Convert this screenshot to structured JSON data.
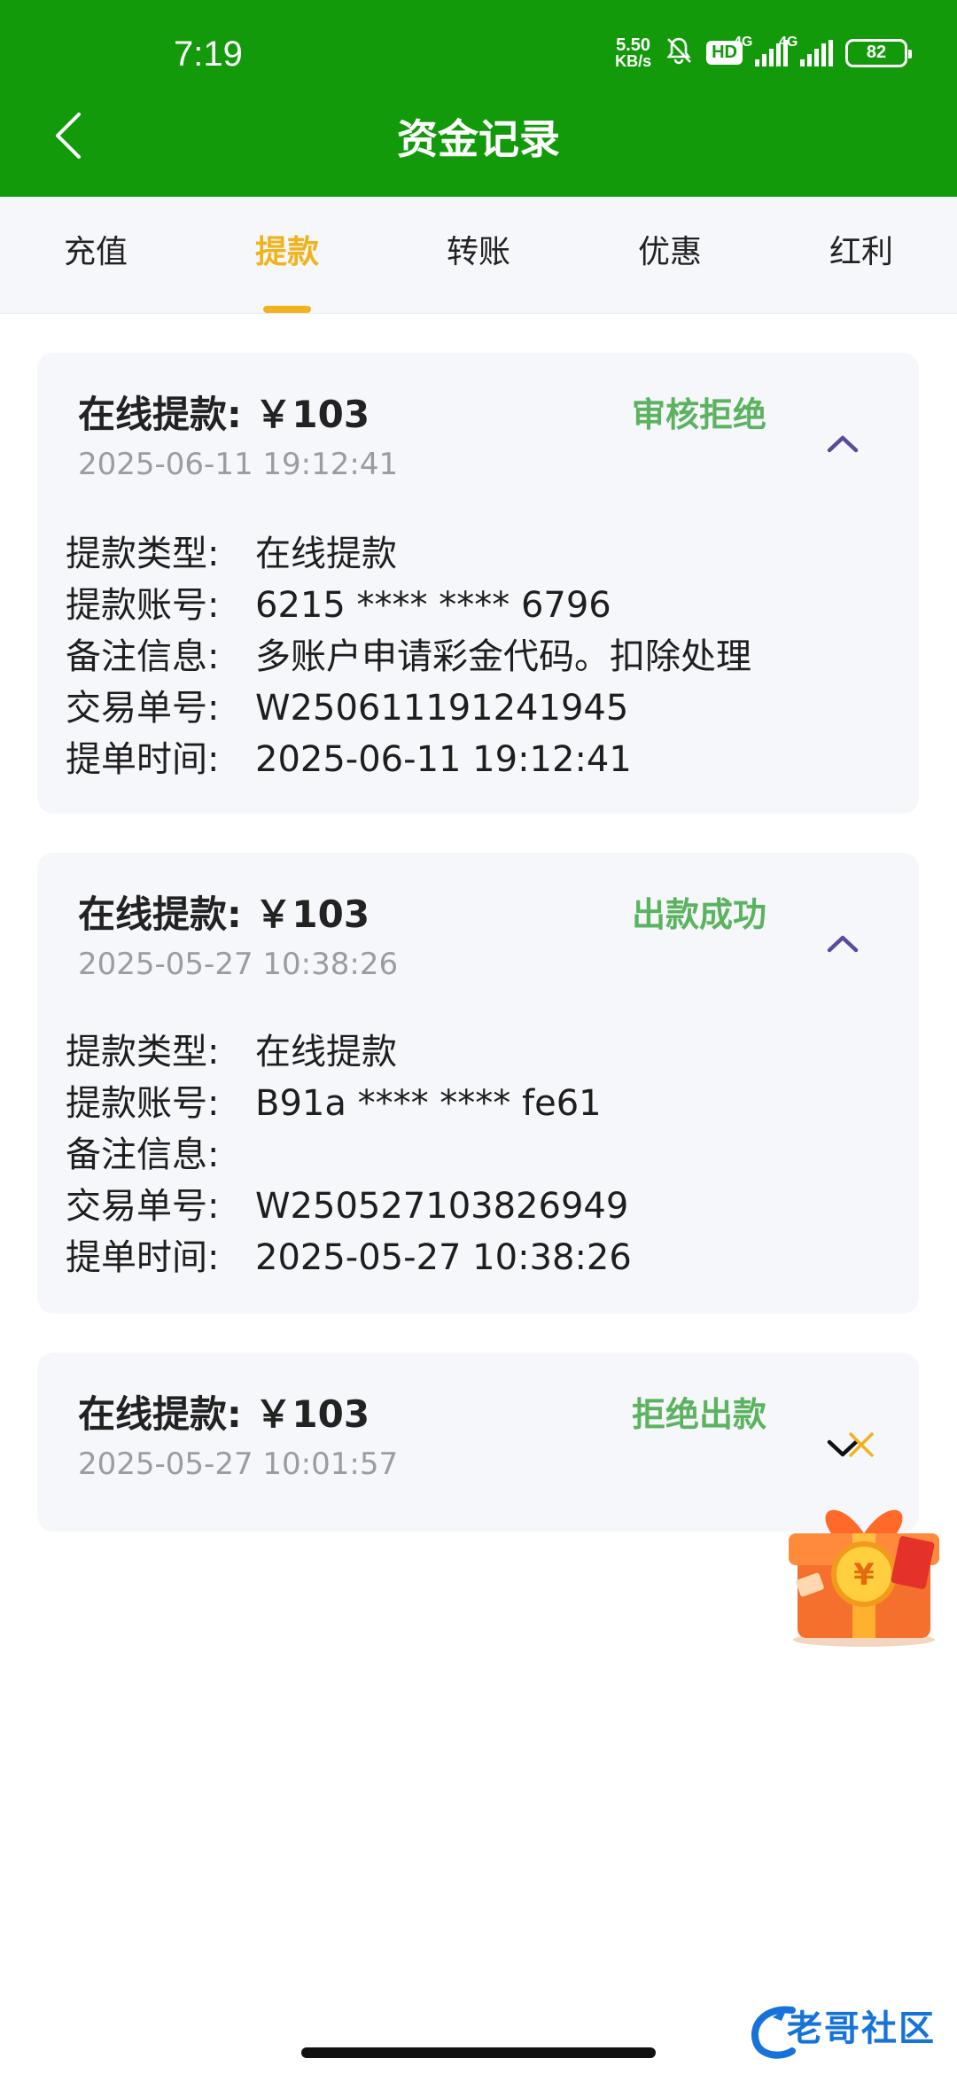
{
  "status_bar": {
    "time": "7:19",
    "net_speed_value": "5.50",
    "net_speed_unit": "KB/s",
    "hd_label": "HD",
    "net_label_1": "4G",
    "net_label_2": "4G",
    "battery": "82",
    "icons": [
      "mute-bell-icon",
      "hd-icon",
      "signal-icon",
      "signal-icon",
      "battery-icon"
    ]
  },
  "header": {
    "title": "资金记录",
    "back_icon": "chevron-left-icon"
  },
  "tabs": [
    {
      "label": "充值",
      "active": false
    },
    {
      "label": "提款",
      "active": true
    },
    {
      "label": "转账",
      "active": false
    },
    {
      "label": "优惠",
      "active": false
    },
    {
      "label": "红利",
      "active": false
    }
  ],
  "colors": {
    "header_bg": "#139a0a",
    "tab_active": "#f0b31c",
    "status_green": "#5bb360",
    "chevron": "#5b4b9b"
  },
  "records": [
    {
      "amount_line": "在线提款: ￥103",
      "date": "2025-06-11 19:12:41",
      "status": "审核拒绝",
      "expanded": true,
      "details": [
        {
          "key": "提款类型:",
          "value": "在线提款"
        },
        {
          "key": "提款账号:",
          "value": "6215 **** **** 6796"
        },
        {
          "key": "备注信息:",
          "value": "多账户申请彩金代码。扣除处理"
        },
        {
          "key": "交易单号:",
          "value": "W250611191241945"
        },
        {
          "key": "提单时间:",
          "value": "2025-06-11 19:12:41"
        }
      ]
    },
    {
      "amount_line": "在线提款: ￥103",
      "date": "2025-05-27 10:38:26",
      "status": "出款成功",
      "expanded": true,
      "details": [
        {
          "key": "提款类型:",
          "value": "在线提款"
        },
        {
          "key": "提款账号:",
          "value": "B91a **** **** fe61"
        },
        {
          "key": "备注信息:",
          "value": ""
        },
        {
          "key": "交易单号:",
          "value": "W250527103826949"
        },
        {
          "key": "提单时间:",
          "value": "2025-05-27 10:38:26"
        }
      ]
    },
    {
      "amount_line": "在线提款: ￥103",
      "date": "2025-05-27 10:01:57",
      "status": "拒绝出款",
      "expanded": false
    }
  ],
  "floating_gift": {
    "icon": "gift-box-icon",
    "close_icon": "close-icon"
  },
  "watermark": {
    "text": "老哥社区"
  }
}
